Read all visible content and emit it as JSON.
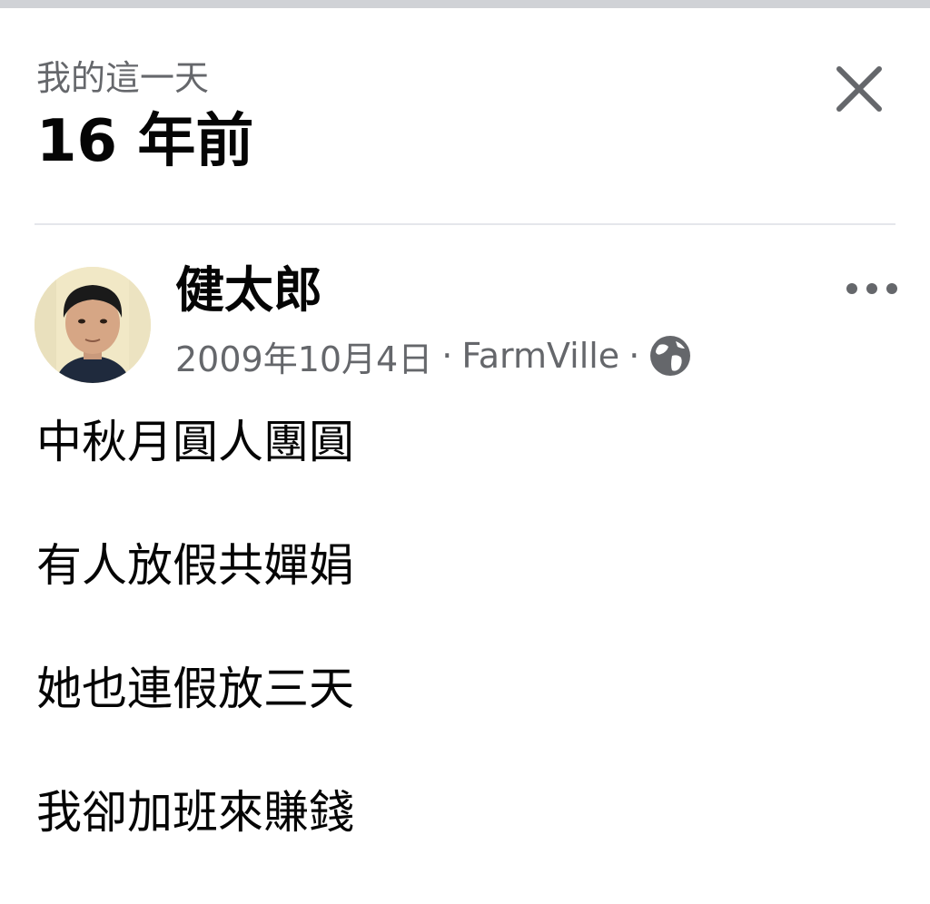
{
  "header": {
    "subtitle": "我的這一天",
    "title": "16 年前"
  },
  "icons": {
    "close": "close-icon",
    "more": "more-horizontal-icon",
    "privacy": "globe-icon"
  },
  "post": {
    "author": "健太郎",
    "date": "2009年10月4日",
    "separator": "·",
    "app": "FarmVille",
    "lines": [
      "中秋月圓人團圓",
      "有人放假共嬋娟",
      "她也連假放三天",
      "我卻加班來賺錢"
    ]
  },
  "colors": {
    "primary_text": "#050505",
    "secondary_text": "#65676b",
    "divider": "#e4e6eb",
    "icon": "#65676b"
  }
}
